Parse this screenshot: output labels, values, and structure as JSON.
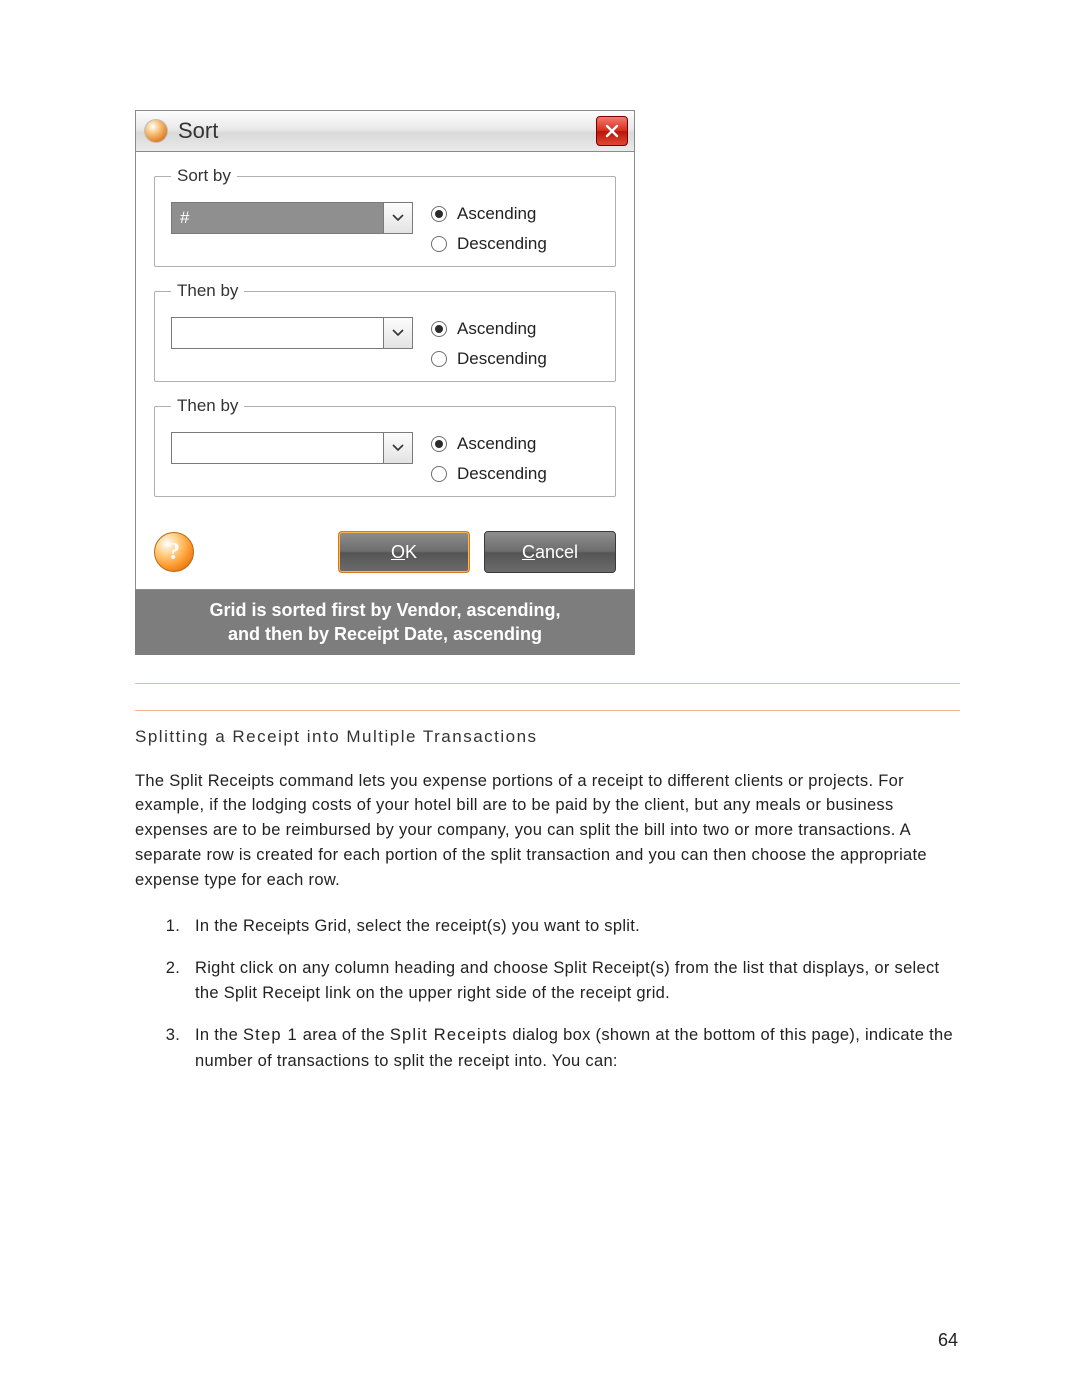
{
  "dialog": {
    "title": "Sort",
    "groups": [
      {
        "legend": "Sort by",
        "value": "#",
        "highlighted": true,
        "ascending": "Ascending",
        "descending": "Descending",
        "selected": "asc"
      },
      {
        "legend": "Then by",
        "value": "",
        "highlighted": false,
        "ascending": "Ascending",
        "descending": "Descending",
        "selected": "asc"
      },
      {
        "legend": "Then by",
        "value": "",
        "highlighted": false,
        "ascending": "Ascending",
        "descending": "Descending",
        "selected": "asc"
      }
    ],
    "ok_label": "K",
    "ok_prefix": "O",
    "cancel_label": "ancel",
    "cancel_prefix": "C"
  },
  "caption": {
    "line1": "Grid is sorted first by Vendor, ascending,",
    "line2": "and then by Receipt Date, ascending"
  },
  "section": {
    "heading": "Splitting a Receipt into Multiple Transactions",
    "paragraph": "The Split Receipts command lets you expense portions of a receipt to different clients or projects. For example, if the lodging costs of your hotel bill are to be paid by the client, but any meals or business expenses are to be reimbursed by your company, you can split the bill into two or more transactions. A separate row is created for each portion of the split transaction and you can then choose the appropriate expense type for each row.",
    "steps": {
      "s1": "In the Receipts Grid, select the receipt(s) you want to split.",
      "s2": "Right click on any column heading and choose Split Receipt(s) from the list that displays, or select the Split Receipt link on the upper right side of the receipt grid.",
      "s3_a": "In the ",
      "s3_kw1": "Step 1",
      "s3_b": " area of the ",
      "s3_kw2": "Split Receipts",
      "s3_c": " dialog box (shown at the bottom of this page), indicate the number of transactions to split the receipt into. You can:"
    }
  },
  "page_number": "64"
}
